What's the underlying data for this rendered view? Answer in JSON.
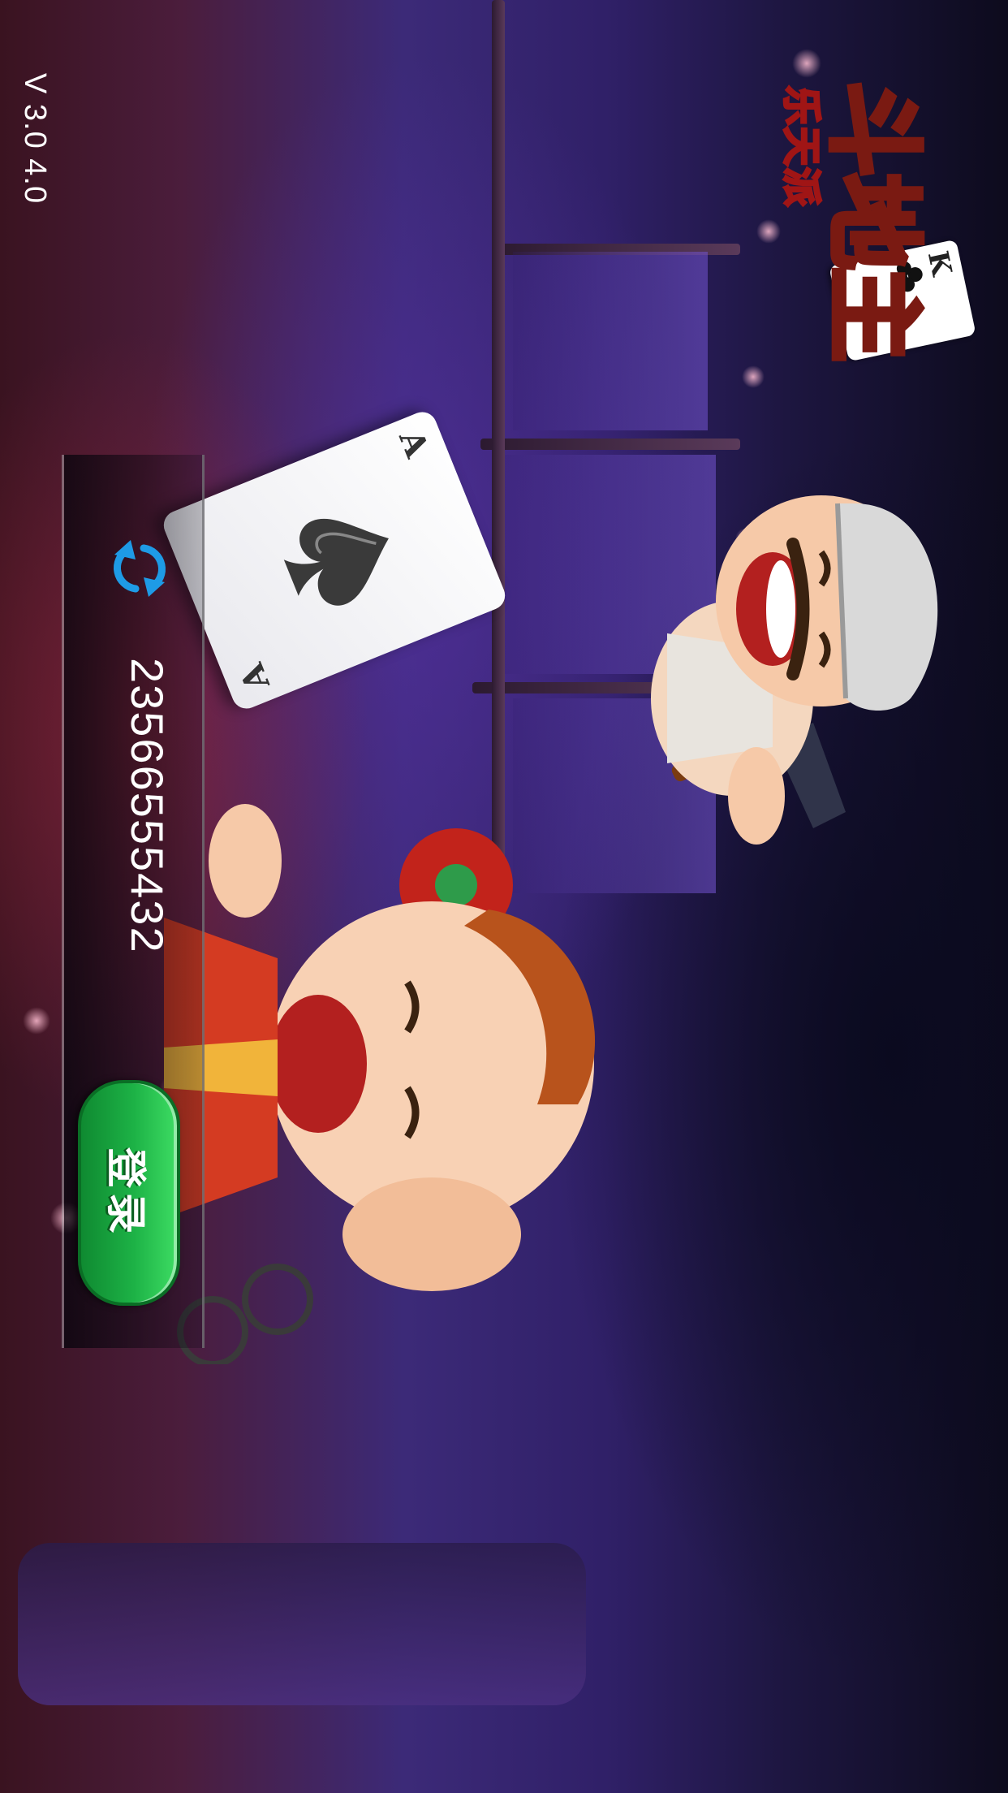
{
  "version": {
    "label": "V 3.0 4.0"
  },
  "logo": {
    "title": "斗地主",
    "subtitle": "乐天派",
    "card_rank": "K",
    "icon": "club-card-icon"
  },
  "background": {
    "ace_card": {
      "rank": "A",
      "suit": "spade"
    }
  },
  "login_panel": {
    "account_number": "23566555432",
    "refresh_icon": "refresh-icon",
    "login_label": "登录"
  },
  "colors": {
    "login_green": "#1db246",
    "refresh_blue": "#1e9be6",
    "logo_yellow": "#ffd21e",
    "logo_red": "#a01515"
  }
}
